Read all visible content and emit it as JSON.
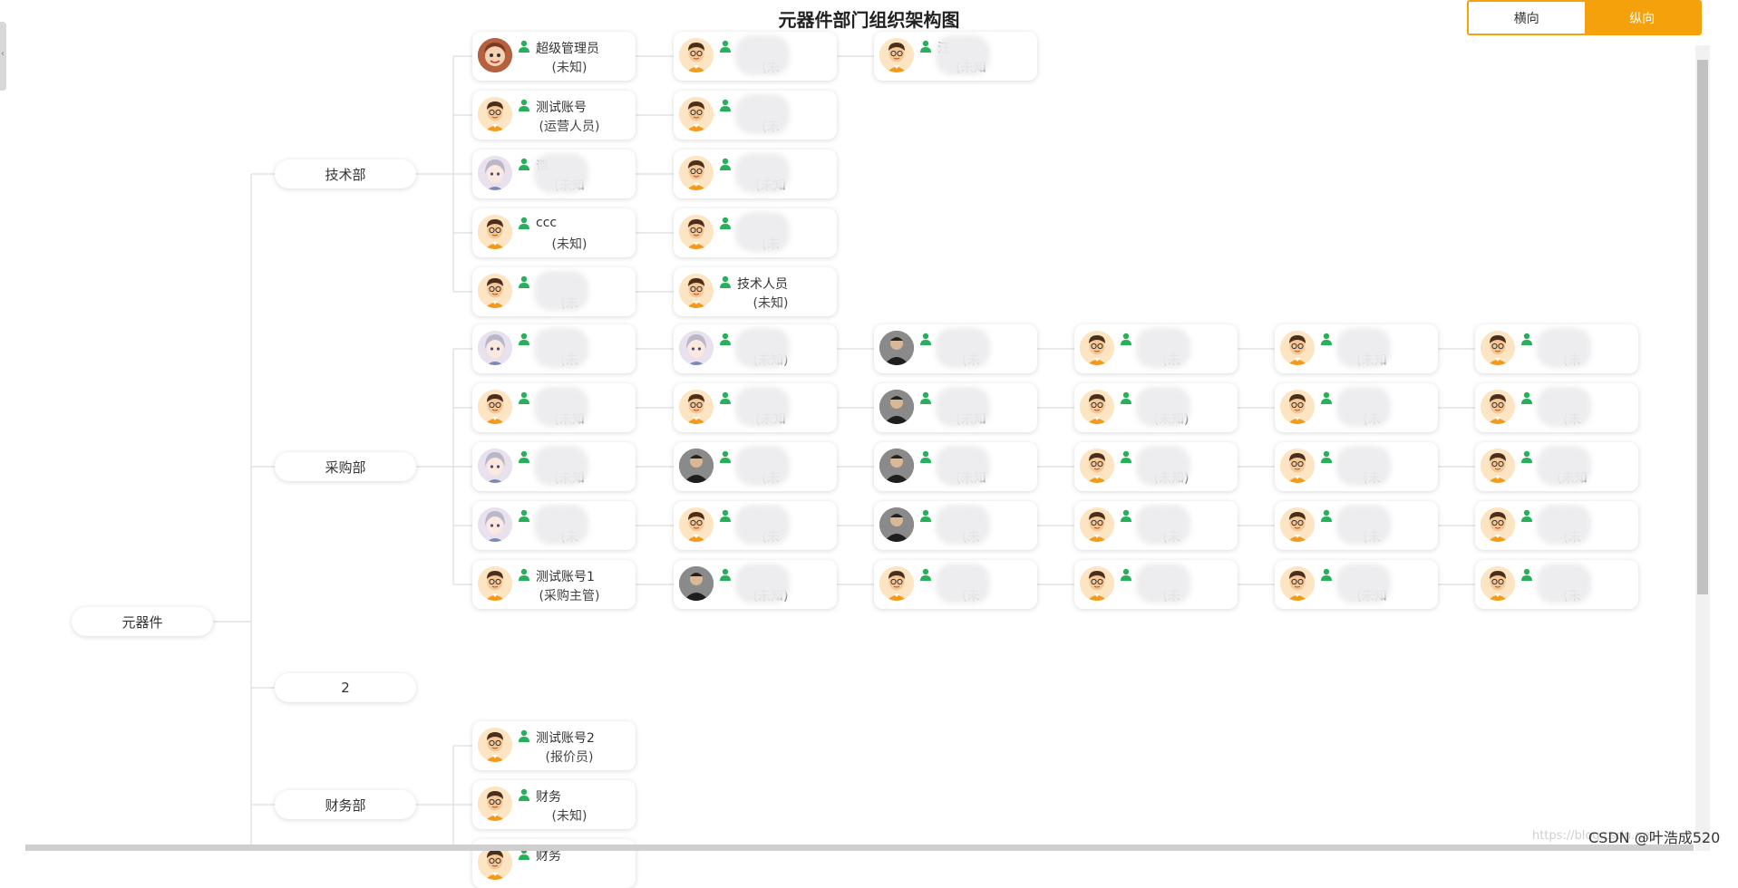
{
  "title": "元器件部门组织架构图",
  "toggle": {
    "horizontal_label": "横向",
    "vertical_label": "纵向",
    "active": "纵向"
  },
  "colors": {
    "accent": "#f5a10c",
    "person_icon": "#27b05a",
    "link": "#dddddd"
  },
  "root": {
    "label": "元器件"
  },
  "departments": [
    {
      "label": "技术部",
      "rows": [
        [
          {
            "avatar": "brown",
            "name": "超级管理员",
            "role": "(未知)"
          },
          {
            "avatar": "cartoon",
            "name": "",
            "role": "(未",
            "blur": true
          },
          {
            "avatar": "cartoon",
            "name": "汪",
            "role": "(未知",
            "blur": true
          }
        ],
        [
          {
            "avatar": "cartoon",
            "name": "测试账号",
            "role": "(运营人员)"
          },
          {
            "avatar": "cartoon",
            "name": "",
            "role": "(未",
            "blur": true
          }
        ],
        [
          {
            "avatar": "anime",
            "name": "谭",
            "role": "(未知",
            "blur": true
          },
          {
            "avatar": "cartoon",
            "name": "",
            "role": "(未知",
            "blur": true
          }
        ],
        [
          {
            "avatar": "cartoon",
            "name": "ccc",
            "role": "(未知)"
          },
          {
            "avatar": "cartoon",
            "name": "",
            "role": "(未",
            "blur": true
          }
        ],
        [
          {
            "avatar": "cartoon",
            "name": "",
            "role": "(未",
            "blur": true
          },
          {
            "avatar": "cartoon",
            "name": "技术人员",
            "role": "(未知)"
          }
        ]
      ]
    },
    {
      "label": "采购部",
      "rows": [
        [
          {
            "avatar": "anime",
            "name": "",
            "role": "(未",
            "blur": true
          },
          {
            "avatar": "anime",
            "name": "",
            "role": "(未知)",
            "blur": true
          },
          {
            "avatar": "photo",
            "name": "",
            "role": "(未",
            "blur": true
          },
          {
            "avatar": "cartoon",
            "name": "",
            "role": "(未",
            "blur": true
          },
          {
            "avatar": "cartoon",
            "name": "",
            "role": "(未知",
            "blur": true
          },
          {
            "avatar": "cartoon",
            "name": "",
            "role": "(未",
            "blur": true
          }
        ],
        [
          {
            "avatar": "cartoon",
            "name": "",
            "role": "(未知",
            "blur": true
          },
          {
            "avatar": "cartoon",
            "name": "",
            "role": "(未知",
            "blur": true
          },
          {
            "avatar": "photo",
            "name": "",
            "role": "(未知",
            "blur": true
          },
          {
            "avatar": "cartoon",
            "name": "",
            "role": "(未知)",
            "blur": true
          },
          {
            "avatar": "cartoon",
            "name": "",
            "role": "(未",
            "blur": true
          },
          {
            "avatar": "cartoon",
            "name": "",
            "role": "(未",
            "blur": true
          }
        ],
        [
          {
            "avatar": "anime",
            "name": "",
            "role": "(未知",
            "blur": true
          },
          {
            "avatar": "photo",
            "name": "",
            "role": "(未",
            "blur": true
          },
          {
            "avatar": "photo",
            "name": "",
            "role": "(未知",
            "blur": true
          },
          {
            "avatar": "cartoon",
            "name": "",
            "role": "(未知)",
            "blur": true
          },
          {
            "avatar": "cartoon",
            "name": "",
            "role": "(未",
            "blur": true
          },
          {
            "avatar": "cartoon",
            "name": "",
            "role": "(未知",
            "blur": true
          }
        ],
        [
          {
            "avatar": "anime",
            "name": "",
            "role": "(未",
            "blur": true
          },
          {
            "avatar": "cartoon",
            "name": "",
            "role": "(未",
            "blur": true
          },
          {
            "avatar": "photo",
            "name": "",
            "role": "(未",
            "blur": true
          },
          {
            "avatar": "cartoon",
            "name": "",
            "role": "(未",
            "blur": true
          },
          {
            "avatar": "cartoon",
            "name": "",
            "role": "(未",
            "blur": true
          },
          {
            "avatar": "cartoon",
            "name": "",
            "role": "(未",
            "blur": true
          }
        ],
        [
          {
            "avatar": "cartoon",
            "name": "测试账号1",
            "role": "(采购主管)"
          },
          {
            "avatar": "photo",
            "name": "",
            "role": "(未知)",
            "blur": true
          },
          {
            "avatar": "cartoon",
            "name": "",
            "role": "(未",
            "blur": true
          },
          {
            "avatar": "cartoon",
            "name": "",
            "role": "(未",
            "blur": true
          },
          {
            "avatar": "cartoon",
            "name": "",
            "role": "(未知",
            "blur": true
          },
          {
            "avatar": "cartoon",
            "name": "",
            "role": "(未",
            "blur": true
          }
        ]
      ]
    },
    {
      "label": "2",
      "rows": []
    },
    {
      "label": "财务部",
      "rows": [
        [
          {
            "avatar": "cartoon",
            "name": "测试账号2",
            "role": "(报价员)"
          }
        ],
        [
          {
            "avatar": "cartoon",
            "name": "财务",
            "role": "(未知)"
          }
        ],
        [
          {
            "avatar": "cartoon",
            "name": "财务",
            "role": ""
          }
        ]
      ]
    }
  ],
  "watermark": "CSDN @叶浩成520",
  "watermark_faint": "https://blog.csdn.net/"
}
